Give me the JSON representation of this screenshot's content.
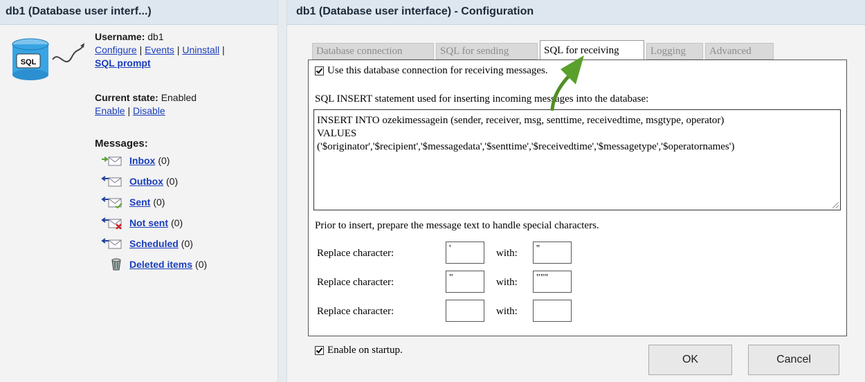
{
  "left": {
    "title": "db1 (Database user interf...)",
    "icon_text": "SQL",
    "username_label": "Username:",
    "username_value": "db1",
    "links": [
      "Configure",
      "Events",
      "Uninstall"
    ],
    "sql_prompt": "SQL prompt",
    "state_label": "Current state:",
    "state_value": "Enabled",
    "enable": "Enable",
    "disable": "Disable",
    "messages_heading": "Messages:",
    "folders": [
      {
        "label": "Inbox",
        "count": "(0)",
        "icon": "inbox-icon"
      },
      {
        "label": "Outbox",
        "count": "(0)",
        "icon": "outbox-icon"
      },
      {
        "label": "Sent",
        "count": "(0)",
        "icon": "sent-icon"
      },
      {
        "label": "Not sent",
        "count": "(0)",
        "icon": "not-sent-icon"
      },
      {
        "label": "Scheduled",
        "count": "(0)",
        "icon": "scheduled-icon"
      },
      {
        "label": "Deleted items",
        "count": "(0)",
        "icon": "trash-icon"
      }
    ]
  },
  "right": {
    "title": "db1 (Database user interface) - Configuration",
    "tabs": [
      {
        "label": "Database connection",
        "active": false
      },
      {
        "label": "SQL for sending",
        "active": false
      },
      {
        "label": "SQL for receiving",
        "active": true
      },
      {
        "label": "Logging",
        "active": false
      },
      {
        "label": "Advanced",
        "active": false
      }
    ],
    "use_connection_label": "Use this database connection for receiving messages.",
    "sql_caption": "SQL INSERT statement used for inserting incoming messages into the database:",
    "sql_text": "INSERT INTO ozekimessagein (sender, receiver, msg, senttime, receivedtime, msgtype, operator)\nVALUES\n('$originator','$recipient','$messagedata','$senttime','$receivedtime','$messagetype','$operatornames')",
    "prior_text": "Prior to insert, prepare the message text to handle special characters.",
    "replace_label": "Replace character:",
    "with_label": "with:",
    "replacements": [
      {
        "from": "'",
        "to": "''"
      },
      {
        "from": "\"",
        "to": "\"\"\""
      },
      {
        "from": "",
        "to": ""
      }
    ],
    "startup_label": "Enable on startup.",
    "ok": "OK",
    "cancel": "Cancel"
  },
  "colors": {
    "link": "#1a3ebc",
    "header_bg": "#dee7ef",
    "arrow": "#5aa02c"
  }
}
